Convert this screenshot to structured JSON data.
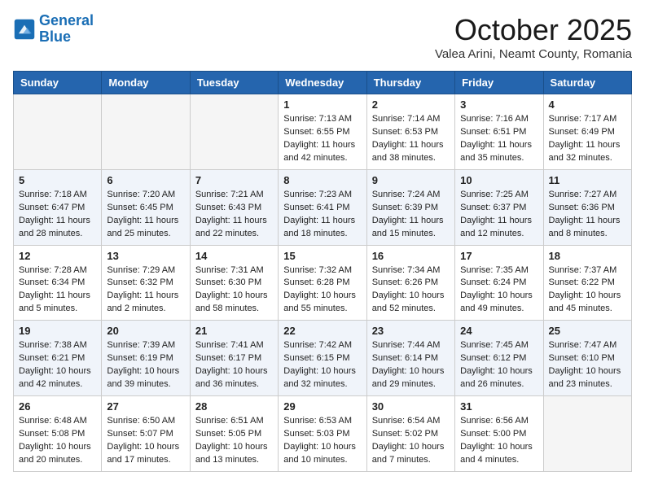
{
  "header": {
    "logo_line1": "General",
    "logo_line2": "Blue",
    "month": "October 2025",
    "location": "Valea Arini, Neamt County, Romania"
  },
  "weekdays": [
    "Sunday",
    "Monday",
    "Tuesday",
    "Wednesday",
    "Thursday",
    "Friday",
    "Saturday"
  ],
  "weeks": [
    [
      {
        "day": "",
        "info": ""
      },
      {
        "day": "",
        "info": ""
      },
      {
        "day": "",
        "info": ""
      },
      {
        "day": "1",
        "info": "Sunrise: 7:13 AM\nSunset: 6:55 PM\nDaylight: 11 hours and 42 minutes."
      },
      {
        "day": "2",
        "info": "Sunrise: 7:14 AM\nSunset: 6:53 PM\nDaylight: 11 hours and 38 minutes."
      },
      {
        "day": "3",
        "info": "Sunrise: 7:16 AM\nSunset: 6:51 PM\nDaylight: 11 hours and 35 minutes."
      },
      {
        "day": "4",
        "info": "Sunrise: 7:17 AM\nSunset: 6:49 PM\nDaylight: 11 hours and 32 minutes."
      }
    ],
    [
      {
        "day": "5",
        "info": "Sunrise: 7:18 AM\nSunset: 6:47 PM\nDaylight: 11 hours and 28 minutes."
      },
      {
        "day": "6",
        "info": "Sunrise: 7:20 AM\nSunset: 6:45 PM\nDaylight: 11 hours and 25 minutes."
      },
      {
        "day": "7",
        "info": "Sunrise: 7:21 AM\nSunset: 6:43 PM\nDaylight: 11 hours and 22 minutes."
      },
      {
        "day": "8",
        "info": "Sunrise: 7:23 AM\nSunset: 6:41 PM\nDaylight: 11 hours and 18 minutes."
      },
      {
        "day": "9",
        "info": "Sunrise: 7:24 AM\nSunset: 6:39 PM\nDaylight: 11 hours and 15 minutes."
      },
      {
        "day": "10",
        "info": "Sunrise: 7:25 AM\nSunset: 6:37 PM\nDaylight: 11 hours and 12 minutes."
      },
      {
        "day": "11",
        "info": "Sunrise: 7:27 AM\nSunset: 6:36 PM\nDaylight: 11 hours and 8 minutes."
      }
    ],
    [
      {
        "day": "12",
        "info": "Sunrise: 7:28 AM\nSunset: 6:34 PM\nDaylight: 11 hours and 5 minutes."
      },
      {
        "day": "13",
        "info": "Sunrise: 7:29 AM\nSunset: 6:32 PM\nDaylight: 11 hours and 2 minutes."
      },
      {
        "day": "14",
        "info": "Sunrise: 7:31 AM\nSunset: 6:30 PM\nDaylight: 10 hours and 58 minutes."
      },
      {
        "day": "15",
        "info": "Sunrise: 7:32 AM\nSunset: 6:28 PM\nDaylight: 10 hours and 55 minutes."
      },
      {
        "day": "16",
        "info": "Sunrise: 7:34 AM\nSunset: 6:26 PM\nDaylight: 10 hours and 52 minutes."
      },
      {
        "day": "17",
        "info": "Sunrise: 7:35 AM\nSunset: 6:24 PM\nDaylight: 10 hours and 49 minutes."
      },
      {
        "day": "18",
        "info": "Sunrise: 7:37 AM\nSunset: 6:22 PM\nDaylight: 10 hours and 45 minutes."
      }
    ],
    [
      {
        "day": "19",
        "info": "Sunrise: 7:38 AM\nSunset: 6:21 PM\nDaylight: 10 hours and 42 minutes."
      },
      {
        "day": "20",
        "info": "Sunrise: 7:39 AM\nSunset: 6:19 PM\nDaylight: 10 hours and 39 minutes."
      },
      {
        "day": "21",
        "info": "Sunrise: 7:41 AM\nSunset: 6:17 PM\nDaylight: 10 hours and 36 minutes."
      },
      {
        "day": "22",
        "info": "Sunrise: 7:42 AM\nSunset: 6:15 PM\nDaylight: 10 hours and 32 minutes."
      },
      {
        "day": "23",
        "info": "Sunrise: 7:44 AM\nSunset: 6:14 PM\nDaylight: 10 hours and 29 minutes."
      },
      {
        "day": "24",
        "info": "Sunrise: 7:45 AM\nSunset: 6:12 PM\nDaylight: 10 hours and 26 minutes."
      },
      {
        "day": "25",
        "info": "Sunrise: 7:47 AM\nSunset: 6:10 PM\nDaylight: 10 hours and 23 minutes."
      }
    ],
    [
      {
        "day": "26",
        "info": "Sunrise: 6:48 AM\nSunset: 5:08 PM\nDaylight: 10 hours and 20 minutes."
      },
      {
        "day": "27",
        "info": "Sunrise: 6:50 AM\nSunset: 5:07 PM\nDaylight: 10 hours and 17 minutes."
      },
      {
        "day": "28",
        "info": "Sunrise: 6:51 AM\nSunset: 5:05 PM\nDaylight: 10 hours and 13 minutes."
      },
      {
        "day": "29",
        "info": "Sunrise: 6:53 AM\nSunset: 5:03 PM\nDaylight: 10 hours and 10 minutes."
      },
      {
        "day": "30",
        "info": "Sunrise: 6:54 AM\nSunset: 5:02 PM\nDaylight: 10 hours and 7 minutes."
      },
      {
        "day": "31",
        "info": "Sunrise: 6:56 AM\nSunset: 5:00 PM\nDaylight: 10 hours and 4 minutes."
      },
      {
        "day": "",
        "info": ""
      }
    ]
  ]
}
